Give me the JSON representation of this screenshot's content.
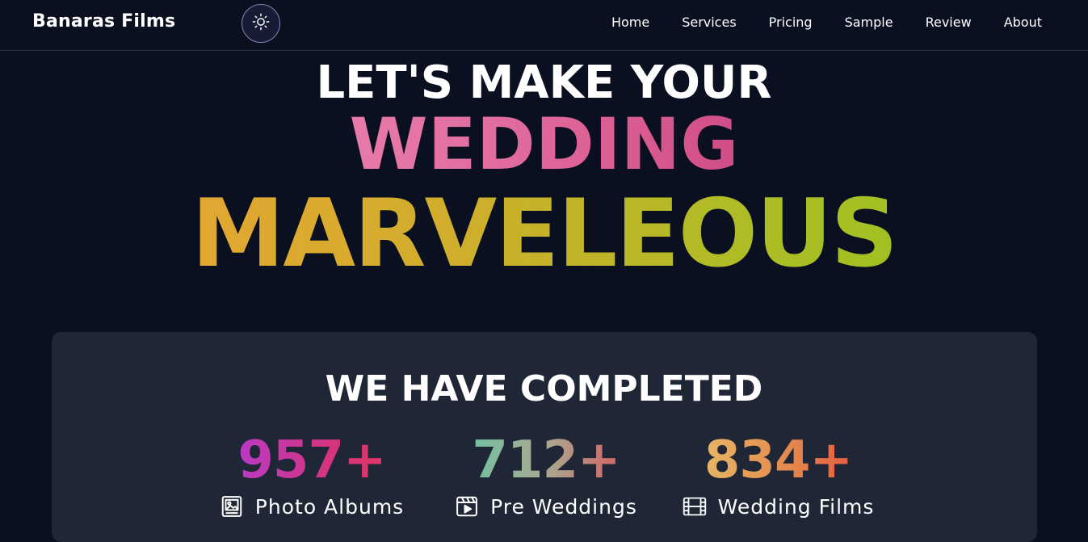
{
  "brand": {
    "name": "Banaras Films"
  },
  "theme_toggle": {
    "icon": "sun-icon"
  },
  "nav": {
    "items": [
      {
        "label": "Home"
      },
      {
        "label": "Services"
      },
      {
        "label": "Pricing"
      },
      {
        "label": "Sample"
      },
      {
        "label": "Review"
      },
      {
        "label": "About"
      }
    ]
  },
  "hero": {
    "line1": "LET'S MAKE YOUR",
    "line2": "WEDDING",
    "line3": "MARVELEOUS"
  },
  "stats": {
    "title": "WE HAVE COMPLETED",
    "items": [
      {
        "number": "957+",
        "label": "Photo Albums",
        "icon": "image-icon"
      },
      {
        "number": "712+",
        "label": "Pre Weddings",
        "icon": "video-icon"
      },
      {
        "number": "834+",
        "label": "Wedding Films",
        "icon": "film-icon"
      }
    ]
  }
}
